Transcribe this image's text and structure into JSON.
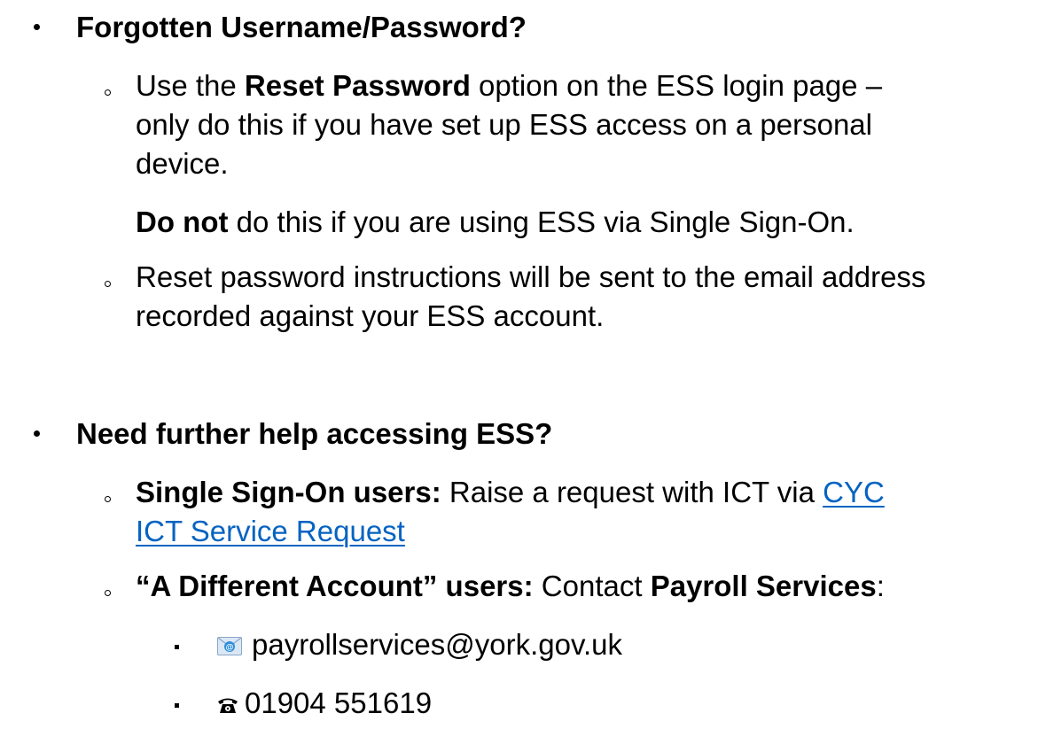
{
  "section1": {
    "heading": "Forgotten Username/Password?",
    "item1": {
      "pre": "Use the ",
      "bold": "Reset Password",
      "post": " option on the ESS login page –",
      "line2": "only do this if you have set up ESS access on a personal",
      "line3": "device."
    },
    "note": {
      "bold": "Do not",
      "rest": " do this if you are using ESS via Single Sign-On."
    },
    "item2": {
      "line1": "Reset password instructions will be sent to the email address",
      "line2": "recorded against your ESS account."
    }
  },
  "section2": {
    "heading": "Need further help accessing ESS?",
    "item1": {
      "bold": "Single Sign-On users:",
      "rest": " Raise a request with ICT via ",
      "link_line1": "CYC",
      "link_line2": "ICT Service Request"
    },
    "item2": {
      "bold1": "“A Different Account” users:",
      "mid": " Contact ",
      "bold2": "Payroll Services",
      "end": ":"
    },
    "contacts": {
      "email": "payrollservices@york.gov.uk",
      "email_icon": "email-envelope-icon",
      "phone": "01904 551619",
      "phone_icon": "telephone-icon"
    }
  }
}
